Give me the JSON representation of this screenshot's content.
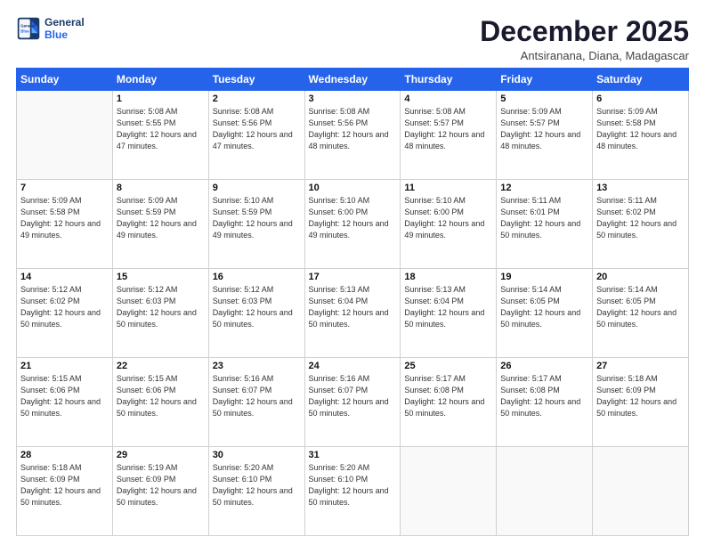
{
  "logo": {
    "line1": "General",
    "line2": "Blue"
  },
  "title": "December 2025",
  "subtitle": "Antsiranana, Diana, Madagascar",
  "weekdays": [
    "Sunday",
    "Monday",
    "Tuesday",
    "Wednesday",
    "Thursday",
    "Friday",
    "Saturday"
  ],
  "weeks": [
    [
      {
        "day": "",
        "sunrise": "",
        "sunset": "",
        "daylight": ""
      },
      {
        "day": "1",
        "sunrise": "Sunrise: 5:08 AM",
        "sunset": "Sunset: 5:55 PM",
        "daylight": "Daylight: 12 hours and 47 minutes."
      },
      {
        "day": "2",
        "sunrise": "Sunrise: 5:08 AM",
        "sunset": "Sunset: 5:56 PM",
        "daylight": "Daylight: 12 hours and 47 minutes."
      },
      {
        "day": "3",
        "sunrise": "Sunrise: 5:08 AM",
        "sunset": "Sunset: 5:56 PM",
        "daylight": "Daylight: 12 hours and 48 minutes."
      },
      {
        "day": "4",
        "sunrise": "Sunrise: 5:08 AM",
        "sunset": "Sunset: 5:57 PM",
        "daylight": "Daylight: 12 hours and 48 minutes."
      },
      {
        "day": "5",
        "sunrise": "Sunrise: 5:09 AM",
        "sunset": "Sunset: 5:57 PM",
        "daylight": "Daylight: 12 hours and 48 minutes."
      },
      {
        "day": "6",
        "sunrise": "Sunrise: 5:09 AM",
        "sunset": "Sunset: 5:58 PM",
        "daylight": "Daylight: 12 hours and 48 minutes."
      }
    ],
    [
      {
        "day": "7",
        "sunrise": "Sunrise: 5:09 AM",
        "sunset": "Sunset: 5:58 PM",
        "daylight": "Daylight: 12 hours and 49 minutes."
      },
      {
        "day": "8",
        "sunrise": "Sunrise: 5:09 AM",
        "sunset": "Sunset: 5:59 PM",
        "daylight": "Daylight: 12 hours and 49 minutes."
      },
      {
        "day": "9",
        "sunrise": "Sunrise: 5:10 AM",
        "sunset": "Sunset: 5:59 PM",
        "daylight": "Daylight: 12 hours and 49 minutes."
      },
      {
        "day": "10",
        "sunrise": "Sunrise: 5:10 AM",
        "sunset": "Sunset: 6:00 PM",
        "daylight": "Daylight: 12 hours and 49 minutes."
      },
      {
        "day": "11",
        "sunrise": "Sunrise: 5:10 AM",
        "sunset": "Sunset: 6:00 PM",
        "daylight": "Daylight: 12 hours and 49 minutes."
      },
      {
        "day": "12",
        "sunrise": "Sunrise: 5:11 AM",
        "sunset": "Sunset: 6:01 PM",
        "daylight": "Daylight: 12 hours and 50 minutes."
      },
      {
        "day": "13",
        "sunrise": "Sunrise: 5:11 AM",
        "sunset": "Sunset: 6:02 PM",
        "daylight": "Daylight: 12 hours and 50 minutes."
      }
    ],
    [
      {
        "day": "14",
        "sunrise": "Sunrise: 5:12 AM",
        "sunset": "Sunset: 6:02 PM",
        "daylight": "Daylight: 12 hours and 50 minutes."
      },
      {
        "day": "15",
        "sunrise": "Sunrise: 5:12 AM",
        "sunset": "Sunset: 6:03 PM",
        "daylight": "Daylight: 12 hours and 50 minutes."
      },
      {
        "day": "16",
        "sunrise": "Sunrise: 5:12 AM",
        "sunset": "Sunset: 6:03 PM",
        "daylight": "Daylight: 12 hours and 50 minutes."
      },
      {
        "day": "17",
        "sunrise": "Sunrise: 5:13 AM",
        "sunset": "Sunset: 6:04 PM",
        "daylight": "Daylight: 12 hours and 50 minutes."
      },
      {
        "day": "18",
        "sunrise": "Sunrise: 5:13 AM",
        "sunset": "Sunset: 6:04 PM",
        "daylight": "Daylight: 12 hours and 50 minutes."
      },
      {
        "day": "19",
        "sunrise": "Sunrise: 5:14 AM",
        "sunset": "Sunset: 6:05 PM",
        "daylight": "Daylight: 12 hours and 50 minutes."
      },
      {
        "day": "20",
        "sunrise": "Sunrise: 5:14 AM",
        "sunset": "Sunset: 6:05 PM",
        "daylight": "Daylight: 12 hours and 50 minutes."
      }
    ],
    [
      {
        "day": "21",
        "sunrise": "Sunrise: 5:15 AM",
        "sunset": "Sunset: 6:06 PM",
        "daylight": "Daylight: 12 hours and 50 minutes."
      },
      {
        "day": "22",
        "sunrise": "Sunrise: 5:15 AM",
        "sunset": "Sunset: 6:06 PM",
        "daylight": "Daylight: 12 hours and 50 minutes."
      },
      {
        "day": "23",
        "sunrise": "Sunrise: 5:16 AM",
        "sunset": "Sunset: 6:07 PM",
        "daylight": "Daylight: 12 hours and 50 minutes."
      },
      {
        "day": "24",
        "sunrise": "Sunrise: 5:16 AM",
        "sunset": "Sunset: 6:07 PM",
        "daylight": "Daylight: 12 hours and 50 minutes."
      },
      {
        "day": "25",
        "sunrise": "Sunrise: 5:17 AM",
        "sunset": "Sunset: 6:08 PM",
        "daylight": "Daylight: 12 hours and 50 minutes."
      },
      {
        "day": "26",
        "sunrise": "Sunrise: 5:17 AM",
        "sunset": "Sunset: 6:08 PM",
        "daylight": "Daylight: 12 hours and 50 minutes."
      },
      {
        "day": "27",
        "sunrise": "Sunrise: 5:18 AM",
        "sunset": "Sunset: 6:09 PM",
        "daylight": "Daylight: 12 hours and 50 minutes."
      }
    ],
    [
      {
        "day": "28",
        "sunrise": "Sunrise: 5:18 AM",
        "sunset": "Sunset: 6:09 PM",
        "daylight": "Daylight: 12 hours and 50 minutes."
      },
      {
        "day": "29",
        "sunrise": "Sunrise: 5:19 AM",
        "sunset": "Sunset: 6:09 PM",
        "daylight": "Daylight: 12 hours and 50 minutes."
      },
      {
        "day": "30",
        "sunrise": "Sunrise: 5:20 AM",
        "sunset": "Sunset: 6:10 PM",
        "daylight": "Daylight: 12 hours and 50 minutes."
      },
      {
        "day": "31",
        "sunrise": "Sunrise: 5:20 AM",
        "sunset": "Sunset: 6:10 PM",
        "daylight": "Daylight: 12 hours and 50 minutes."
      },
      {
        "day": "",
        "sunrise": "",
        "sunset": "",
        "daylight": ""
      },
      {
        "day": "",
        "sunrise": "",
        "sunset": "",
        "daylight": ""
      },
      {
        "day": "",
        "sunrise": "",
        "sunset": "",
        "daylight": ""
      }
    ]
  ]
}
